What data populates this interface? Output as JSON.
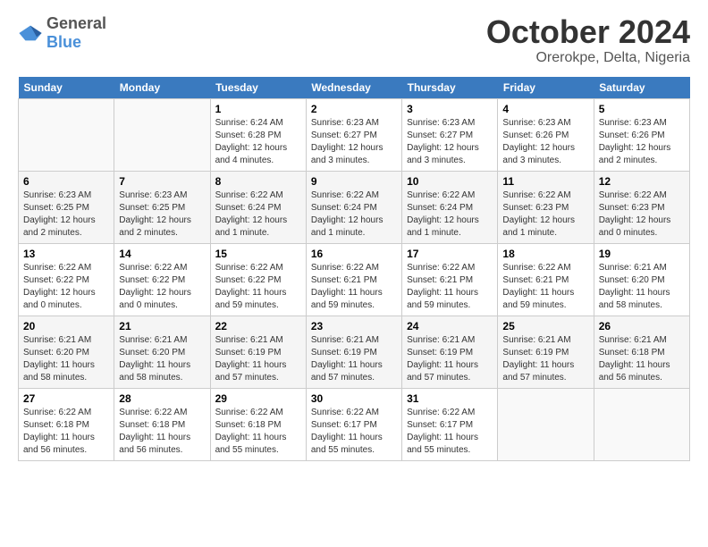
{
  "logo": {
    "general": "General",
    "blue": "Blue"
  },
  "header": {
    "month": "October 2024",
    "location": "Orerokpe, Delta, Nigeria"
  },
  "weekdays": [
    "Sunday",
    "Monday",
    "Tuesday",
    "Wednesday",
    "Thursday",
    "Friday",
    "Saturday"
  ],
  "weeks": [
    [
      {
        "day": "",
        "info": ""
      },
      {
        "day": "",
        "info": ""
      },
      {
        "day": "1",
        "info": "Sunrise: 6:24 AM\nSunset: 6:28 PM\nDaylight: 12 hours and 4 minutes."
      },
      {
        "day": "2",
        "info": "Sunrise: 6:23 AM\nSunset: 6:27 PM\nDaylight: 12 hours and 3 minutes."
      },
      {
        "day": "3",
        "info": "Sunrise: 6:23 AM\nSunset: 6:27 PM\nDaylight: 12 hours and 3 minutes."
      },
      {
        "day": "4",
        "info": "Sunrise: 6:23 AM\nSunset: 6:26 PM\nDaylight: 12 hours and 3 minutes."
      },
      {
        "day": "5",
        "info": "Sunrise: 6:23 AM\nSunset: 6:26 PM\nDaylight: 12 hours and 2 minutes."
      }
    ],
    [
      {
        "day": "6",
        "info": "Sunrise: 6:23 AM\nSunset: 6:25 PM\nDaylight: 12 hours and 2 minutes."
      },
      {
        "day": "7",
        "info": "Sunrise: 6:23 AM\nSunset: 6:25 PM\nDaylight: 12 hours and 2 minutes."
      },
      {
        "day": "8",
        "info": "Sunrise: 6:22 AM\nSunset: 6:24 PM\nDaylight: 12 hours and 1 minute."
      },
      {
        "day": "9",
        "info": "Sunrise: 6:22 AM\nSunset: 6:24 PM\nDaylight: 12 hours and 1 minute."
      },
      {
        "day": "10",
        "info": "Sunrise: 6:22 AM\nSunset: 6:24 PM\nDaylight: 12 hours and 1 minute."
      },
      {
        "day": "11",
        "info": "Sunrise: 6:22 AM\nSunset: 6:23 PM\nDaylight: 12 hours and 1 minute."
      },
      {
        "day": "12",
        "info": "Sunrise: 6:22 AM\nSunset: 6:23 PM\nDaylight: 12 hours and 0 minutes."
      }
    ],
    [
      {
        "day": "13",
        "info": "Sunrise: 6:22 AM\nSunset: 6:22 PM\nDaylight: 12 hours and 0 minutes."
      },
      {
        "day": "14",
        "info": "Sunrise: 6:22 AM\nSunset: 6:22 PM\nDaylight: 12 hours and 0 minutes."
      },
      {
        "day": "15",
        "info": "Sunrise: 6:22 AM\nSunset: 6:22 PM\nDaylight: 11 hours and 59 minutes."
      },
      {
        "day": "16",
        "info": "Sunrise: 6:22 AM\nSunset: 6:21 PM\nDaylight: 11 hours and 59 minutes."
      },
      {
        "day": "17",
        "info": "Sunrise: 6:22 AM\nSunset: 6:21 PM\nDaylight: 11 hours and 59 minutes."
      },
      {
        "day": "18",
        "info": "Sunrise: 6:22 AM\nSunset: 6:21 PM\nDaylight: 11 hours and 59 minutes."
      },
      {
        "day": "19",
        "info": "Sunrise: 6:21 AM\nSunset: 6:20 PM\nDaylight: 11 hours and 58 minutes."
      }
    ],
    [
      {
        "day": "20",
        "info": "Sunrise: 6:21 AM\nSunset: 6:20 PM\nDaylight: 11 hours and 58 minutes."
      },
      {
        "day": "21",
        "info": "Sunrise: 6:21 AM\nSunset: 6:20 PM\nDaylight: 11 hours and 58 minutes."
      },
      {
        "day": "22",
        "info": "Sunrise: 6:21 AM\nSunset: 6:19 PM\nDaylight: 11 hours and 57 minutes."
      },
      {
        "day": "23",
        "info": "Sunrise: 6:21 AM\nSunset: 6:19 PM\nDaylight: 11 hours and 57 minutes."
      },
      {
        "day": "24",
        "info": "Sunrise: 6:21 AM\nSunset: 6:19 PM\nDaylight: 11 hours and 57 minutes."
      },
      {
        "day": "25",
        "info": "Sunrise: 6:21 AM\nSunset: 6:19 PM\nDaylight: 11 hours and 57 minutes."
      },
      {
        "day": "26",
        "info": "Sunrise: 6:21 AM\nSunset: 6:18 PM\nDaylight: 11 hours and 56 minutes."
      }
    ],
    [
      {
        "day": "27",
        "info": "Sunrise: 6:22 AM\nSunset: 6:18 PM\nDaylight: 11 hours and 56 minutes."
      },
      {
        "day": "28",
        "info": "Sunrise: 6:22 AM\nSunset: 6:18 PM\nDaylight: 11 hours and 56 minutes."
      },
      {
        "day": "29",
        "info": "Sunrise: 6:22 AM\nSunset: 6:18 PM\nDaylight: 11 hours and 55 minutes."
      },
      {
        "day": "30",
        "info": "Sunrise: 6:22 AM\nSunset: 6:17 PM\nDaylight: 11 hours and 55 minutes."
      },
      {
        "day": "31",
        "info": "Sunrise: 6:22 AM\nSunset: 6:17 PM\nDaylight: 11 hours and 55 minutes."
      },
      {
        "day": "",
        "info": ""
      },
      {
        "day": "",
        "info": ""
      }
    ]
  ]
}
